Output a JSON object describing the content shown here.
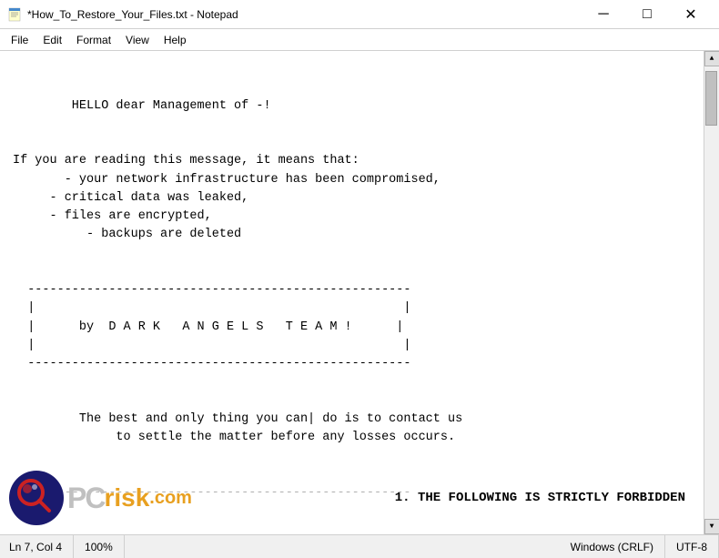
{
  "titlebar": {
    "icon": "notepad",
    "title": "*How_To_Restore_Your_Files.txt - Notepad",
    "minimize": "─",
    "maximize": "□",
    "close": "✕"
  },
  "menubar": {
    "file": "File",
    "edit": "Edit",
    "format": "Format",
    "view": "View",
    "help": "Help"
  },
  "editor": {
    "content": "\n\n        HELLO dear Management of -!\n\n\nIf you are reading this message, it means that:\n       - your network infrastructure has been compromised,\n     - critical data was leaked,\n     - files are encrypted,\n          - backups are deleted\n\n\n  ----------------------------------------------------\n  |                                                  |\n  |      by  D A R K   A N G E L S   T E A M !      |\n  |                                                  |\n  ----------------------------------------------------\n\n\n         The best and only thing you can| do is to contact us\n              to settle the matter before any losses occurs.\n\n\n  ----------------------------------------------------"
  },
  "watermark": {
    "pc_text": "PC",
    "risk_text": "risk",
    "com_text": ".com",
    "warning": "1. THE FOLLOWING IS STRICTLY FORBIDDEN"
  },
  "statusbar": {
    "position": "Ln 7, Col 4",
    "zoom": "100%",
    "line_ending": "Windows (CRLF)",
    "encoding": "UTF-8"
  }
}
